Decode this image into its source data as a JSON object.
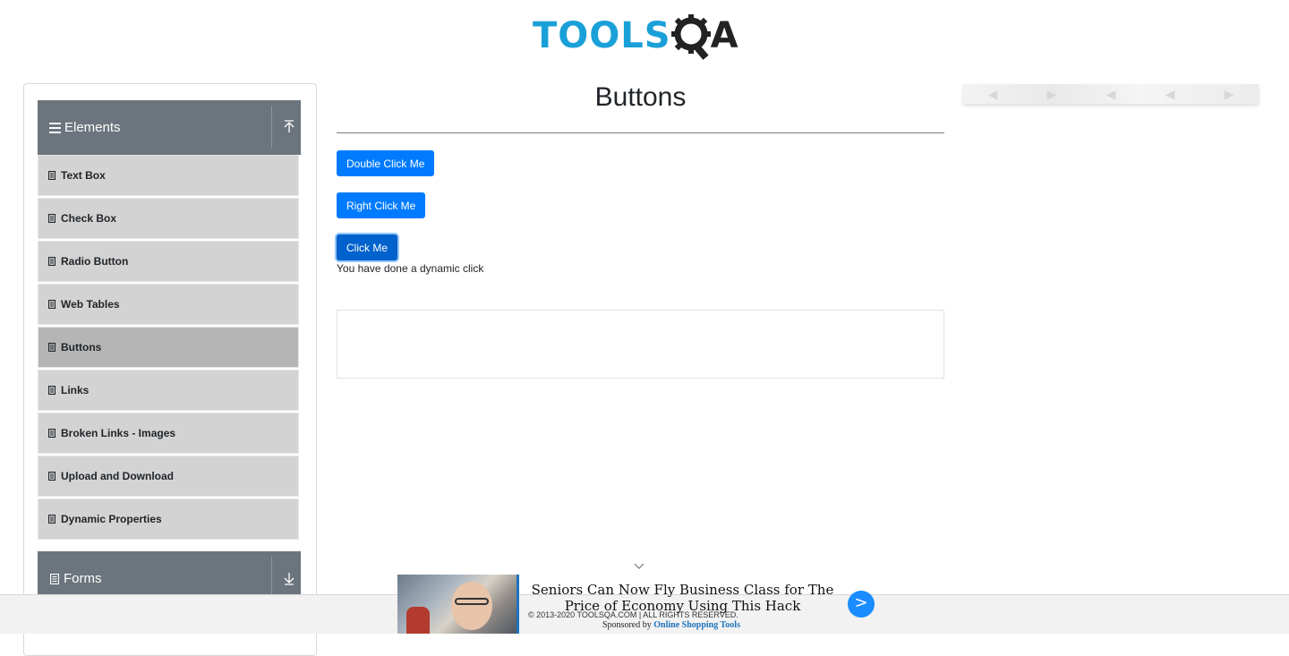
{
  "header": {
    "logo_text_blue": "TOOLS",
    "logo_text_dark": "A",
    "logo_alt": "TOOLSQA"
  },
  "sidebar": {
    "groups": [
      {
        "title": "Elements",
        "icon": "menu-icon",
        "arrow": "arrow-up-icon"
      },
      {
        "title": "Forms",
        "icon": "document-icon",
        "arrow": "arrow-down-icon"
      }
    ],
    "items": [
      {
        "label": "Text Box",
        "active": false
      },
      {
        "label": "Check Box",
        "active": false
      },
      {
        "label": "Radio Button",
        "active": false
      },
      {
        "label": "Web Tables",
        "active": false
      },
      {
        "label": "Buttons",
        "active": true
      },
      {
        "label": "Links",
        "active": false
      },
      {
        "label": "Broken Links - Images",
        "active": false
      },
      {
        "label": "Upload and Download",
        "active": false
      },
      {
        "label": "Dynamic Properties",
        "active": false
      }
    ]
  },
  "main": {
    "title": "Buttons",
    "buttons": {
      "double_click": "Double Click Me",
      "right_click": "Right Click Me",
      "click": "Click Me"
    },
    "message": "You have done a dynamic click"
  },
  "footer": {
    "copyright": "© 2013-2020 TOOLSQA.COM | ALL RIGHTS RESERVED.",
    "sponsored_by": "Sponsored by",
    "sponsor_name": "Online Shopping Tools"
  },
  "ad": {
    "headline": "Seniors Can Now Fly Business Class for The Price of Economy Using This Hack",
    "arrow": ">"
  },
  "colors": {
    "accent": "#007bff",
    "logo_blue": "#1aa0d8",
    "sidebar_header": "#6c757d",
    "sidebar_item": "#d3d3d3",
    "sidebar_item_active": "#b5b5b5"
  }
}
